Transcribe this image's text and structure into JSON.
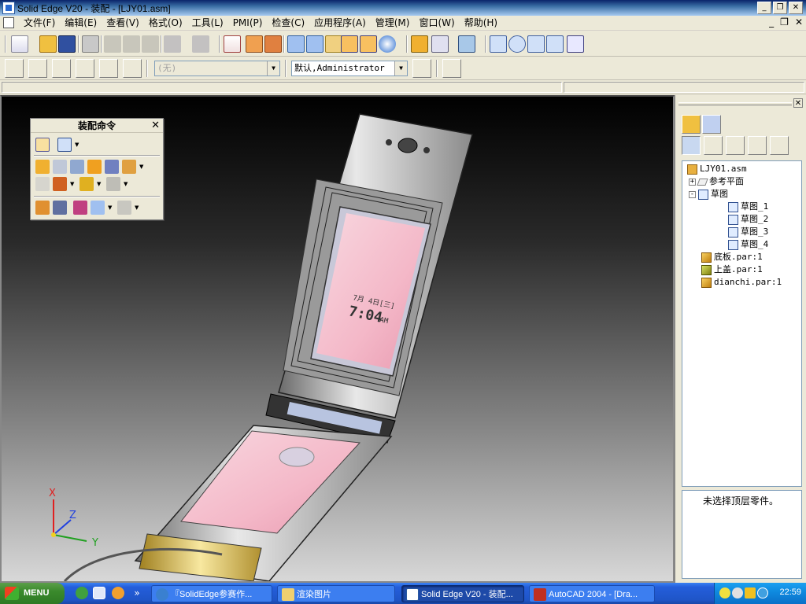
{
  "window": {
    "title": "Solid Edge V20 - 装配 - [LJY01.asm]",
    "controls": [
      "_",
      "❐",
      "✕"
    ]
  },
  "menubar": {
    "items": [
      "文件(F)",
      "编辑(E)",
      "查看(V)",
      "格式(O)",
      "工具(L)",
      "PMI(P)",
      "检查(C)",
      "应用程序(A)",
      "管理(M)",
      "窗口(W)",
      "帮助(H)"
    ],
    "mdi_controls": [
      "_",
      "❐",
      "✕"
    ]
  },
  "toolbar2": {
    "layer_combo": "(无)",
    "user_combo": "默认,Administrator"
  },
  "palette": {
    "title": "装配命令",
    "close": "✕"
  },
  "viewport": {
    "axis_labels": {
      "x": "X",
      "y": "Y",
      "z": "Z"
    },
    "phone_screen": {
      "date": "7月 4日[三]",
      "time": "7:04",
      "ampm": "AM"
    }
  },
  "pathfinder": {
    "close": "✕",
    "tree": [
      {
        "label": "LJY01.asm",
        "icon": "assembly-icon",
        "level": 0
      },
      {
        "label": "参考平面",
        "icon": "reference-plane-icon",
        "level": 1,
        "expander": "+"
      },
      {
        "label": "草图",
        "icon": "sketch-icon",
        "level": 1,
        "expander": "-"
      },
      {
        "label": "草图_1",
        "icon": "sketch-icon",
        "level": 2
      },
      {
        "label": "草图_2",
        "icon": "sketch-icon",
        "level": 2
      },
      {
        "label": "草图_3",
        "icon": "sketch-icon",
        "level": 2
      },
      {
        "label": "草图_4",
        "icon": "sketch-icon",
        "level": 2
      },
      {
        "label": "底板.par:1",
        "icon": "part-icon",
        "level": 1
      },
      {
        "label": "上盖.par:1",
        "icon": "part-icon",
        "level": 1
      },
      {
        "label": "dianchi.par:1",
        "icon": "part-icon",
        "level": 1
      }
    ],
    "info_text": "未选择顶层零件。"
  },
  "taskbar": {
    "start_label": "MENU",
    "tasks": [
      {
        "label": "『SolidEdge参赛作...",
        "active": false
      },
      {
        "label": "渲染图片",
        "active": false
      },
      {
        "label": "Solid Edge V20 - 装配...",
        "active": true
      },
      {
        "label": "AutoCAD 2004 - [Dra...",
        "active": false
      }
    ],
    "clock": "22:59"
  },
  "colors": {
    "viewport_top": "#000000",
    "viewport_bottom": "#d8d8d8",
    "taskbar_blue": "#245edb",
    "start_green": "#3a8a2c",
    "phone_screen_pink": "#f4b8c8"
  }
}
